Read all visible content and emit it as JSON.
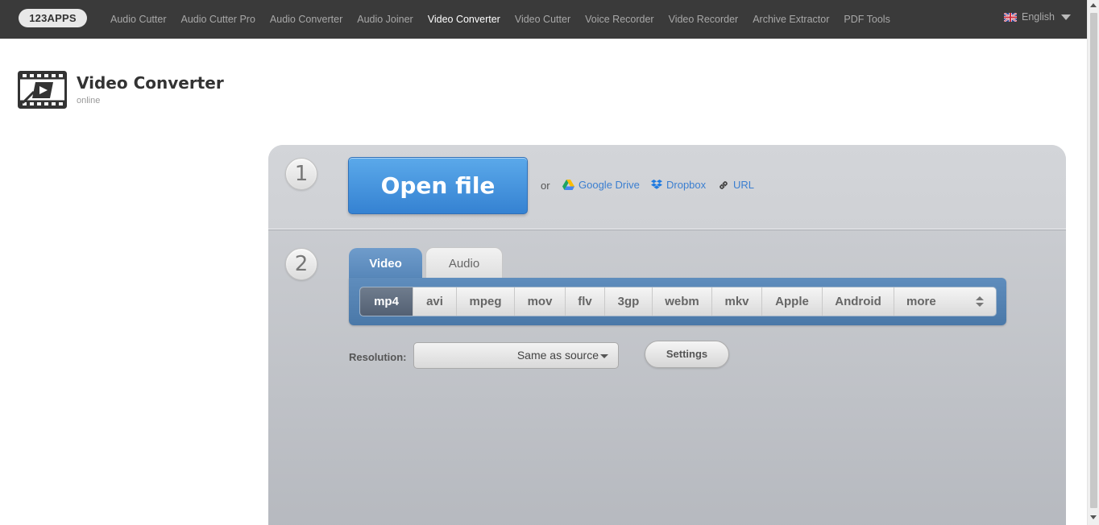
{
  "topbar": {
    "logo": "123APPS",
    "nav": [
      {
        "label": "Audio Cutter",
        "active": false
      },
      {
        "label": "Audio Cutter Pro",
        "active": false
      },
      {
        "label": "Audio Converter",
        "active": false
      },
      {
        "label": "Audio Joiner",
        "active": false
      },
      {
        "label": "Video Converter",
        "active": true
      },
      {
        "label": "Video Cutter",
        "active": false
      },
      {
        "label": "Voice Recorder",
        "active": false
      },
      {
        "label": "Video Recorder",
        "active": false
      },
      {
        "label": "Archive Extractor",
        "active": false
      },
      {
        "label": "PDF Tools",
        "active": false
      }
    ],
    "language": "English",
    "language_icon": "uk-flag-icon"
  },
  "app": {
    "title": "Video Converter",
    "subtitle": "online",
    "icon": "film-clapper-icon"
  },
  "step1": {
    "number": "1",
    "open_label": "Open file",
    "or_label": "or",
    "sources": [
      {
        "label": "Google Drive",
        "icon": "google-drive-icon"
      },
      {
        "label": "Dropbox",
        "icon": "dropbox-icon"
      },
      {
        "label": "URL",
        "icon": "link-icon"
      }
    ]
  },
  "step2": {
    "number": "2",
    "tabs": [
      {
        "label": "Video",
        "active": true
      },
      {
        "label": "Audio",
        "active": false
      }
    ],
    "formats": [
      "mp4",
      "avi",
      "mpeg",
      "mov",
      "flv",
      "3gp",
      "webm",
      "mkv",
      "Apple",
      "Android"
    ],
    "selected_format": "mp4",
    "more_label": "more",
    "resolution_label": "Resolution:",
    "resolution_value": "Same as source",
    "settings_label": "Settings"
  },
  "colors": {
    "topbar_bg": "#3a3a3a",
    "accent_blue": "#3a7ed0",
    "open_button": "#4a95df",
    "tab_active": "#5f8dbd"
  }
}
